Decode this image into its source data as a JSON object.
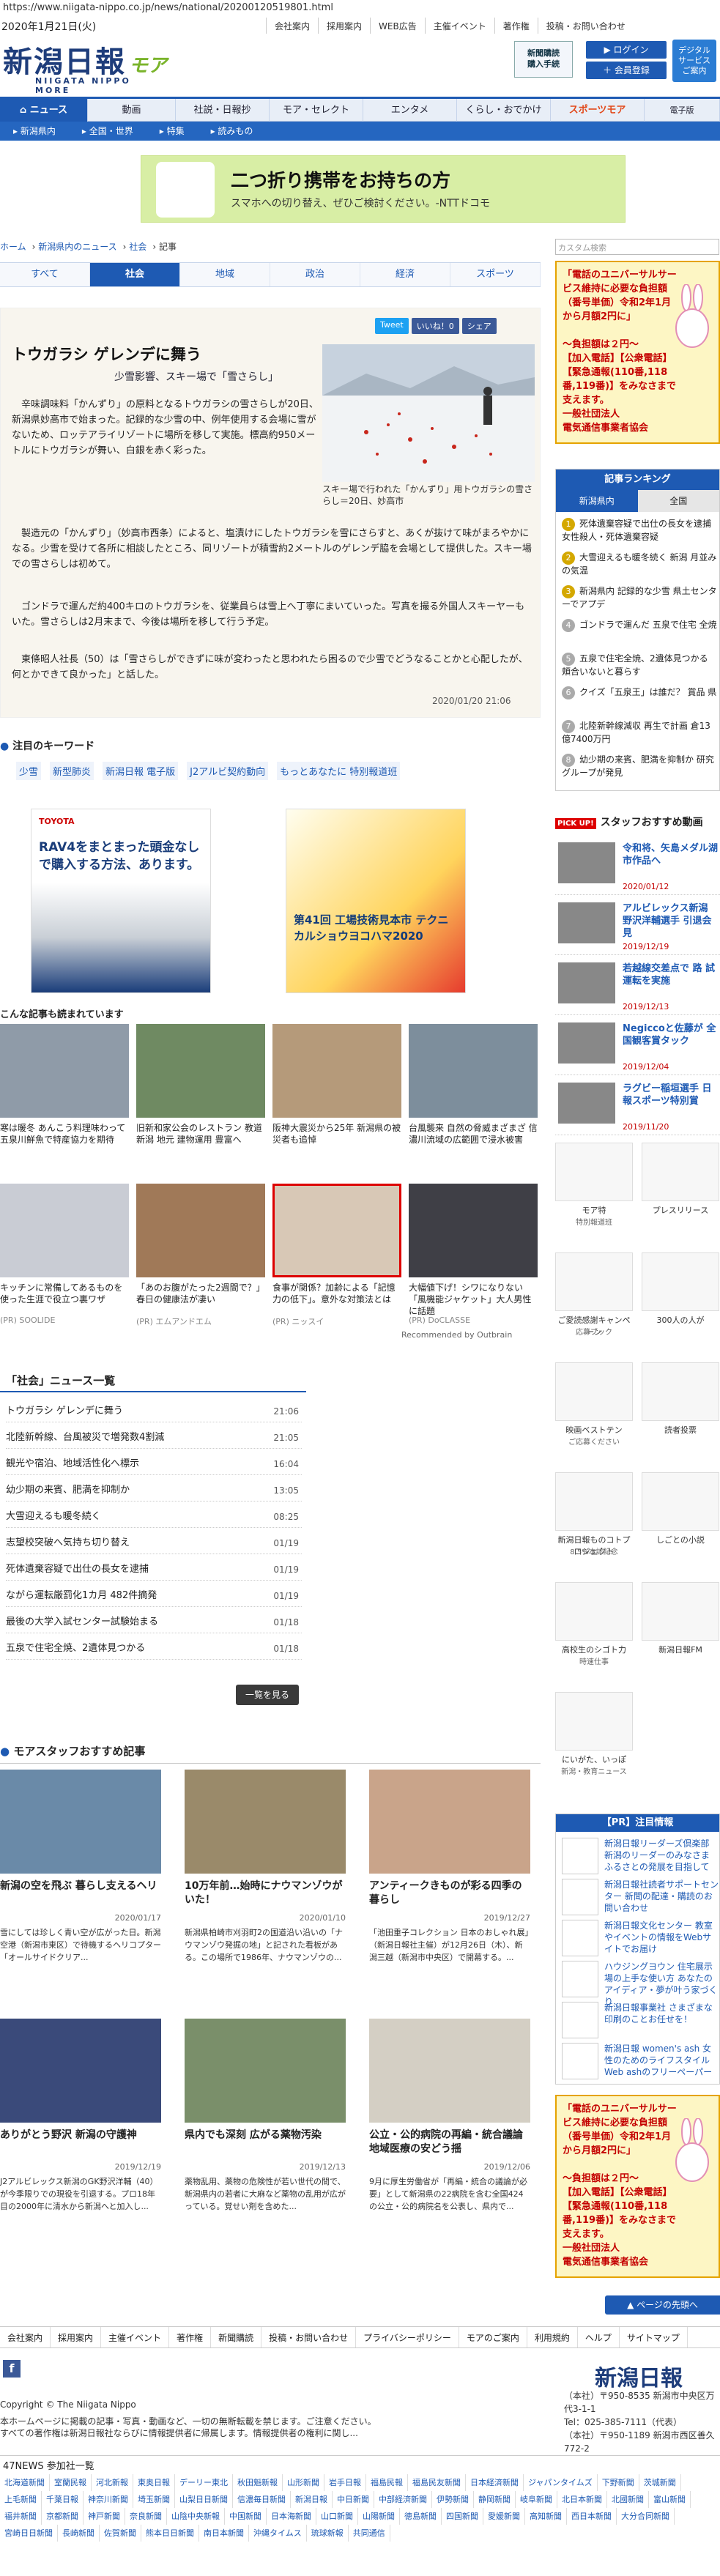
{
  "url": "https://www.niigata-nippo.co.jp/news/national/20200120519801.html",
  "date": "2020年1月21日(火)",
  "top_links": [
    "会社案内",
    "採用案内",
    "WEB広告",
    "主催イベント",
    "著作権",
    "投稿・お問い合わせ"
  ],
  "logo": {
    "main": "新潟日報",
    "moa": "モア",
    "sub": "NIIGATA NIPPO MORE"
  },
  "member": {
    "label": "新聞購読\n購入手続",
    "login": "ログイン",
    "register": "会員登録",
    "digital": "デジタル\nサービス\nご案内"
  },
  "gnav": [
    "ニュース",
    "動画",
    "社説・日報抄",
    "モア・セレクト",
    "エンタメ",
    "くらし・おでかけ",
    "スポーツモア",
    "電子版"
  ],
  "subnav": [
    "新潟県内",
    "全国・世界",
    "特集",
    "読みもの"
  ],
  "ad_banner": {
    "title": "二つ折り携帯をお持ちの方",
    "sub": "スマホへの切り替え、ぜひご検討ください。-NTTドコモ"
  },
  "breadcrumb": [
    "ホーム",
    "新潟県内のニュース",
    "社会",
    "記事"
  ],
  "section_tabs": [
    "すべて",
    "社会",
    "地域",
    "政治",
    "経済",
    "スポーツ"
  ],
  "share": [
    "Tweet",
    "いいね！0",
    "シェア"
  ],
  "article": {
    "title": "トウガラシ ゲレンデに舞う",
    "subtitle": "少雪影響、スキー場で「雪さらし」",
    "caption": "スキー場で行われた「かんずり」用トウガラシの雪さらし＝20日、妙高市",
    "paragraphs": [
      "辛味調味料「かんずり」の原料となるトウガラシの雪さらしが20日、新潟県妙高市で始まった。記録的な少雪の中、例年使用する会場に雪がないため、ロッテアライリゾートに場所を移して実施。標高約950メートルにトウガラシが舞い、白銀を赤く彩った。",
      "製造元の「かんずり」（妙高市西条）によると、塩漬けにしたトウガラシを雪にさらすと、あくが抜けて味がまろやかになる。少雪を受けて各所に相談したところ、同リゾートが積雪約2メートルのゲレンデ脇を会場として提供した。スキー場での雪さらしは初めて。",
      "ゴンドラで運んだ約400キロのトウガラシを、従業員らは雪上へ丁寧にまいていった。写真を撮る外国人スキーヤーもいた。雪さらしは2月末まで、今後は場所を移して行う予定。",
      "東條昭人社長（50）は「雪さらしができずに味が変わったと思われたら困るので少雪でどうなることかと心配したが、何とかできて良かった」と話した。"
    ],
    "datetime": "2020/01/20 21:06"
  },
  "keywords_title": "注目のキーワード",
  "keywords": [
    "少雪",
    "新型肺炎",
    "新潟日報 電子版",
    "J2アルビ契約動向",
    "もっとあなたに 特別報道班"
  ],
  "ads": {
    "ad1": "RAV4をまとまった頭金なしで購入する方法、あります。",
    "ad2": "第41回 工場技術見本市 テクニカルショウヨコハマ2020"
  },
  "reco_title": "こんな記事も読まれています",
  "reco": [
    {
      "cap": "寒は暖冬 あんこう料理味わって 五泉川鮮魚で特産協力を期待",
      "pr": ""
    },
    {
      "cap": "旧新和家公会のレストラン 教道 新潟 地元 建物運用 豊富へ",
      "pr": ""
    },
    {
      "cap": "阪神大震災から25年 新潟県の被災者も追悼",
      "pr": ""
    },
    {
      "cap": "台風襲来 自然の脅威まざまざ 信濃川流域の広範囲で浸水被害",
      "pr": ""
    },
    {
      "cap": "キッチンに常備してあるものを使った生涯で役立つ裏ワザ",
      "pr": "(PR) SOOLIDE"
    },
    {
      "cap": "「あのお腹がたった2週間で？」春日の健康法が凄い",
      "pr": "(PR) エムアンドエム"
    },
    {
      "cap": "食事が関係？加齢による「記憶力の低下」。意外な対策法とは",
      "pr": "(PR) ニッスイ"
    },
    {
      "cap": "大幅値下げ！シワになりない「風機能ジャケット」大人男性に話題",
      "pr": "(PR) DoCLASSE"
    }
  ],
  "outbrain": "Recommended by Outbrain",
  "news_list": {
    "title": "「社会」ニュース一覧",
    "items": [
      {
        "t": "トウガラシ ゲレンデに舞う",
        "d": "21:06"
      },
      {
        "t": "北陸新幹線、台風被災で増発数4割減",
        "d": "21:05"
      },
      {
        "t": "観光や宿泊、地域活性化へ標示",
        "d": "16:04"
      },
      {
        "t": "幼少期の来賓、肥満を抑制か",
        "d": "13:05"
      },
      {
        "t": "大雪迎えるも暖冬続く",
        "d": "08:25"
      },
      {
        "t": "志望校突破へ気持ち切り替え",
        "d": "01/19"
      },
      {
        "t": "死体遺棄容疑で出仕の長女を逮捕",
        "d": "01/19"
      },
      {
        "t": "ながら運転厳罰化1カ月 482件摘発",
        "d": "01/19"
      },
      {
        "t": "最後の大学入試センター試験始まる",
        "d": "01/18"
      },
      {
        "t": "五泉で住宅全焼、2遺体見つかる",
        "d": "01/18"
      }
    ],
    "more": "一覧を見る"
  },
  "staff": {
    "title": "モアスタッフおすすめ記事",
    "items": [
      {
        "t": "新潟の空を飛ぶ 暮らし支えるヘリ",
        "d": "2020/01/17",
        "x": "雪にしては珍しく青い空が広がった日。新潟空港（新潟市東区）で待機するヘリコプター「オールサイドクリア..."
      },
      {
        "t": "10万年前…始時にナウマンゾウがいた！",
        "d": "2020/01/10",
        "x": "新潟県柏崎市刈羽町2の国道沿い沿いの「ナウマンゾウ発掘の地」と記された看板がある。この場所で1986年、ナウマンゾウの..."
      },
      {
        "t": "アンティークきものが彩る四季の暮らし",
        "d": "2019/12/27",
        "x": "「池田重子コレクション 日本のおしゃれ展」（新潟日報社主催）が12月26日（木）、新潟三越（新潟市中央区）で開幕する。..."
      },
      {
        "t": "ありがとう野沢 新潟の守護神",
        "d": "2019/12/19",
        "x": "J2アルビレックス新潟のGK野沢洋輔（40）が今季限りでの現役を引退する。プロ18年目の2000年に清水から新潟へと加入し..."
      },
      {
        "t": "県内でも深刻 広がる薬物汚染",
        "d": "2019/12/13",
        "x": "薬物乱用、薬物の危険性が若い世代の間で、新潟県内の若者に大麻など薬物の乱用が広がっている。覚せい剤を含めた..."
      },
      {
        "t": "公立・公的病院の再編・統合議論 地域医療の安どう揺",
        "d": "2019/12/06",
        "x": "9月に厚生労働省が「再編・統合の議論が必要」として新潟県の22病院を含む全国424の公立・公的病院名を公表し、県内で..."
      }
    ]
  },
  "footer_links": [
    "会社案内",
    "採用案内",
    "主催イベント",
    "著作権",
    "新聞購読",
    "投稿・お問い合わせ",
    "プライバシーポリシー",
    "モアのご案内",
    "利用規約",
    "ヘルプ",
    "サイトマップ"
  ],
  "footer_logo": "新潟日報",
  "copyright": "Copyright © The Niigata Nippo",
  "notice": "本ホームページに掲載の記事・写真・動画など、一切の無断転載を禁じます。ご注意ください。\nすべての著作権は新潟日報社ならびに情報提供者に帰属します。情報提供者の権利に関し...",
  "address": "（本社）〒950-8535 新潟市中央区万代3-1-1\nTel：025-385-7111（代表）\n（本社）〒950-1189 新潟市西区善久772-2",
  "n47": "47NEWS 参加社一覧",
  "papers": [
    "北海道新聞",
    "室蘭民報",
    "河北新報",
    "東奥日報",
    "デーリー東北",
    "秋田魁新報",
    "山形新聞",
    "岩手日報",
    "福島民報",
    "福島民友新聞",
    "日本経済新聞",
    "ジャパンタイムズ",
    "下野新聞",
    "茨城新聞",
    "上毛新聞",
    "千葉日報",
    "神奈川新聞",
    "埼玉新聞",
    "山梨日日新聞",
    "信濃毎日新聞",
    "新潟日報",
    "中日新聞",
    "中部経済新聞",
    "伊勢新聞",
    "静岡新聞",
    "岐阜新聞",
    "北日本新聞",
    "北國新聞",
    "富山新聞",
    "福井新聞",
    "京都新聞",
    "神戸新聞",
    "奈良新聞",
    "山陰中央新報",
    "中国新聞",
    "日本海新聞",
    "山口新聞",
    "山陽新聞",
    "徳島新聞",
    "四国新聞",
    "愛媛新聞",
    "高知新聞",
    "西日本新聞",
    "大分合同新聞",
    "宮崎日日新聞",
    "長崎新聞",
    "佐賀新聞",
    "熊本日日新聞",
    "南日本新聞",
    "沖縄タイムス",
    "琉球新報",
    "共同通信"
  ],
  "right": {
    "search": "カスタム検索",
    "ad_title": "「電話のユニバーサルサービス維持に必要な負担額（番号単価）令和2年1月から月額2円に」\n\n～負担額は２円～\n【加入電話】【公衆電話】【緊急通報(110番,118番,119番)】をみなさまで支えます。\n一般社団法人\n電気通信事業者協会",
    "ranking_title": "記事ランキング",
    "ranking_tabs": [
      "新潟県内",
      "全国"
    ],
    "ranking": [
      "死体遺棄容疑で出仕の長女を逮捕 女性殺人・死体遺棄容疑",
      "大雪迎えるも暖冬続く 新潟 月並みの気温",
      "新潟県内 記録的な少雪 県土センターでアプデ",
      "ゴンドラで運んだ 五泉で住宅 全焼",
      "五泉で住宅全焼、2遺体見つかる 頬合いないと暮らす",
      "クイズ「五泉王」は誰だ？ 賞品 県",
      "北陸新幹線減収 再生で計画 倉13億7400万円",
      "幼少期の来賓、肥満を抑制か 研究グループが発見"
    ],
    "pick_title": "スタッフおすすめ動画",
    "pick_label": "PICK UP!",
    "picks": [
      {
        "t": "令和将、矢島メダル湖市作品へ",
        "d": "2020/01/12"
      },
      {
        "t": "アルビレックス新潟 野沢洋輔選手 引退会見",
        "d": "2019/12/19"
      },
      {
        "t": "若越線交差点で 路 試運転を実施",
        "d": "2019/12/13"
      },
      {
        "t": "Negiccoと佐藤が 全国観客賞タック",
        "d": "2019/12/04"
      },
      {
        "t": "ラグビー稲垣選手 日報スポーツ特別賞",
        "d": "2019/11/20"
      }
    ],
    "banners": [
      {
        "cap": "モア特",
        "sub": "特別報道班"
      },
      {
        "cap": "プレスリリース",
        "sub": ""
      },
      {
        "cap": "ご愛読感謝キャンペーン",
        "sub": "応募ブック"
      },
      {
        "cap": "300人の人が",
        "sub": ""
      },
      {
        "cap": "映画ベストテン",
        "sub": "ご応募ください"
      },
      {
        "cap": "読者投票",
        "sub": ""
      },
      {
        "cap": "新潟日報ものコトプロジェクト",
        "sub": "8.5%本誌記念"
      },
      {
        "cap": "しごとの小説",
        "sub": ""
      },
      {
        "cap": "高校生のシゴト力",
        "sub": "時速仕事"
      },
      {
        "cap": "新潟日報FM",
        "sub": ""
      },
      {
        "cap": "にいがた、いっぽ",
        "sub": "新潟・教育ニュース"
      }
    ],
    "pr_title": "【PR】注目情報",
    "pr_items": [
      "新潟日報リーダーズ倶楽部 新潟のリーダーのみなさま ふるさとの発展を目指して",
      "新潟日報社読者サポートセンター 新聞の配達・購読のお問い合わせ",
      "新潟日報文化センター 教室やイベントの情報をWebサイトでお届け",
      "ハウジングヨウン 住宅展示場の上手な使い方 あなたのアイディア・夢が叶う家づくり",
      "新潟日報事業社 さまざまな印刷のことお任せを！",
      "新潟日報 women's ash 女性のためのライフスタイル Web ashのフリーペーパー"
    ],
    "ad2_title": "「電話のユニバーサルサービス維持に必要な負担額（番号単価）令和2年1月から月額2円に」\n\n～負担額は２円～\n【加入電話】【公衆電話】【緊急通報(110番,118番,119番)】をみなさまで支えます。\n一般社団法人\n電気通信事業者協会",
    "pagetop": "ページの先頭へ"
  },
  "colors": {
    "primary": "#1e5ab3",
    "logo": "#1e3d7b",
    "moa": "#7ab42b",
    "ad_bg": "#fdf6c4",
    "red": "#c40000"
  }
}
